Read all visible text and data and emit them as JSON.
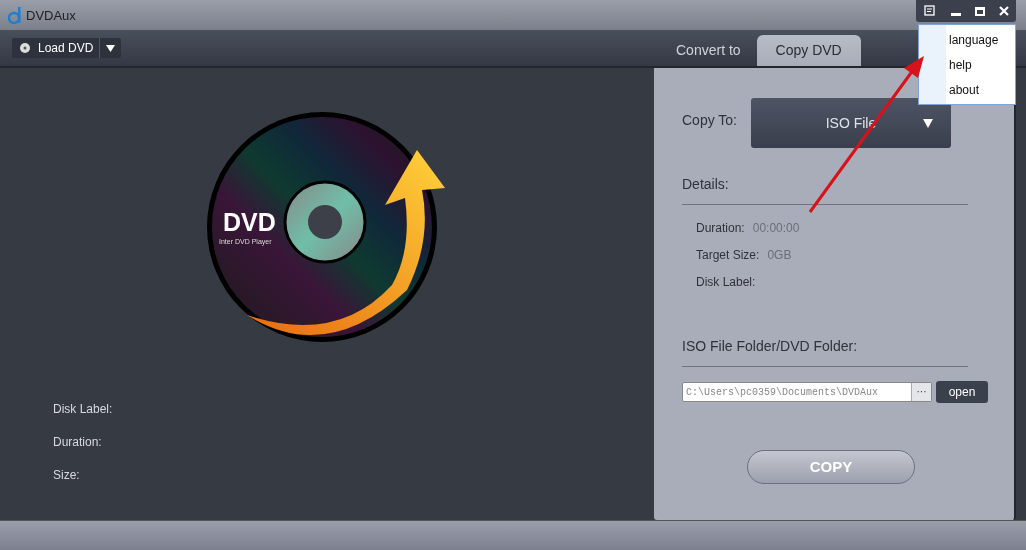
{
  "window": {
    "title": "DVDAux"
  },
  "menu": {
    "items": [
      {
        "label": "language"
      },
      {
        "label": "help"
      },
      {
        "label": "about"
      }
    ]
  },
  "toolbar": {
    "load_button": "Load DVD"
  },
  "tabs": [
    {
      "label": "Convert to",
      "selected": false
    },
    {
      "label": "Copy DVD",
      "selected": true
    }
  ],
  "preview": {
    "logo_title": "DVD",
    "logo_subtitle": "Inter DVD Player",
    "info": [
      {
        "label": "Disk Label:"
      },
      {
        "label": "Duration:"
      },
      {
        "label": "Size:"
      }
    ]
  },
  "copy_panel": {
    "copy_to_label": "Copy To:",
    "copy_to_value": "ISO File",
    "details_heading": "Details:",
    "details": [
      {
        "label": "Duration:",
        "value": "00:00:00"
      },
      {
        "label": "Target Size:",
        "value": "0GB"
      },
      {
        "label": "Disk Label:"
      }
    ],
    "folder_heading": "ISO File Folder/DVD Folder:",
    "folder_path": "C:\\Users\\pc0359\\Documents\\DVDAux",
    "browse_button": "···",
    "open_button": "open",
    "copy_button": "COPY"
  }
}
